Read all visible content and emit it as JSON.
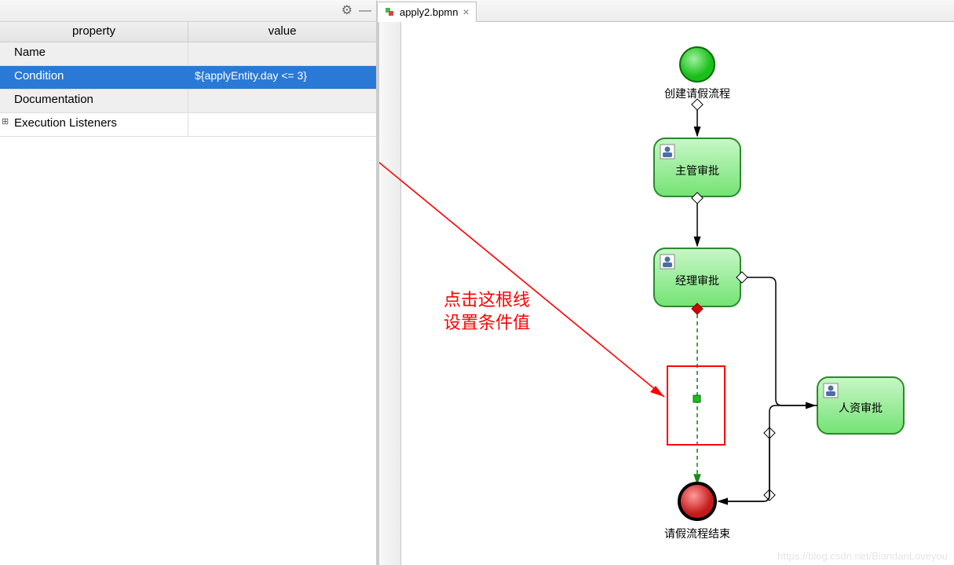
{
  "panel": {
    "header_property": "property",
    "header_value": "value",
    "rows": [
      {
        "prop": "Name",
        "val": "",
        "selected": false,
        "expandable": false
      },
      {
        "prop": "Condition",
        "val": "${applyEntity.day <= 3}",
        "selected": true,
        "expandable": false
      },
      {
        "prop": "Documentation",
        "val": "",
        "selected": false,
        "expandable": false
      },
      {
        "prop": "Execution Listeners",
        "val": "",
        "selected": false,
        "expandable": true
      }
    ]
  },
  "tab": {
    "label": "apply2.bpmn"
  },
  "diagram": {
    "start_label": "创建请假流程",
    "task1": "主管审批",
    "task2": "经理审批",
    "task3": "人资审批",
    "end_label": "请假流程结束"
  },
  "annotation": {
    "line1": "点击这根线",
    "line2": "设置条件值"
  },
  "watermark": "https://blog.csdn.net/BiandanLoveyou"
}
